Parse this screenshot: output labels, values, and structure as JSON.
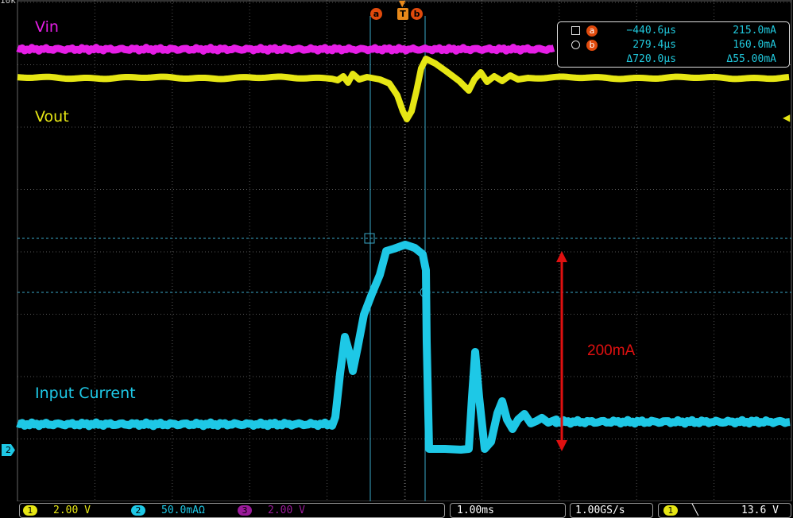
{
  "traces": {
    "vin_label": "Vin",
    "vout_label": "Vout",
    "input_current_label": "Input Current",
    "annotation_label": "200mA"
  },
  "colors": {
    "vin": "#e61ee6",
    "vout": "#e6e614",
    "input_current": "#1ec8e6",
    "annotation": "#e01010",
    "cursor": "#e04a0c"
  },
  "cursors": {
    "a_badge": "a",
    "b_badge": "b",
    "trigger_label": "T",
    "a_time": "−440.6µs",
    "a_value": "215.0mA",
    "b_time": "279.4µs",
    "b_value": "160.0mA",
    "delta_time": "Δ720.0µs",
    "delta_value": "Δ55.00mA"
  },
  "status": {
    "ch1_num": "1",
    "ch1_scale": "2.00 V",
    "ch2_num": "2",
    "ch2_scale": "50.0mAΩ",
    "ch3_num": "3",
    "ch3_scale": "2.00 V",
    "timebase": "1.00ms",
    "sample_rate": "1.00GS/s",
    "trig_ch": "1",
    "trig_slope": "╲",
    "trig_level": "13.6 V"
  },
  "markers": {
    "ch2_ground": "2",
    "top_left_fragment": "10k"
  }
}
